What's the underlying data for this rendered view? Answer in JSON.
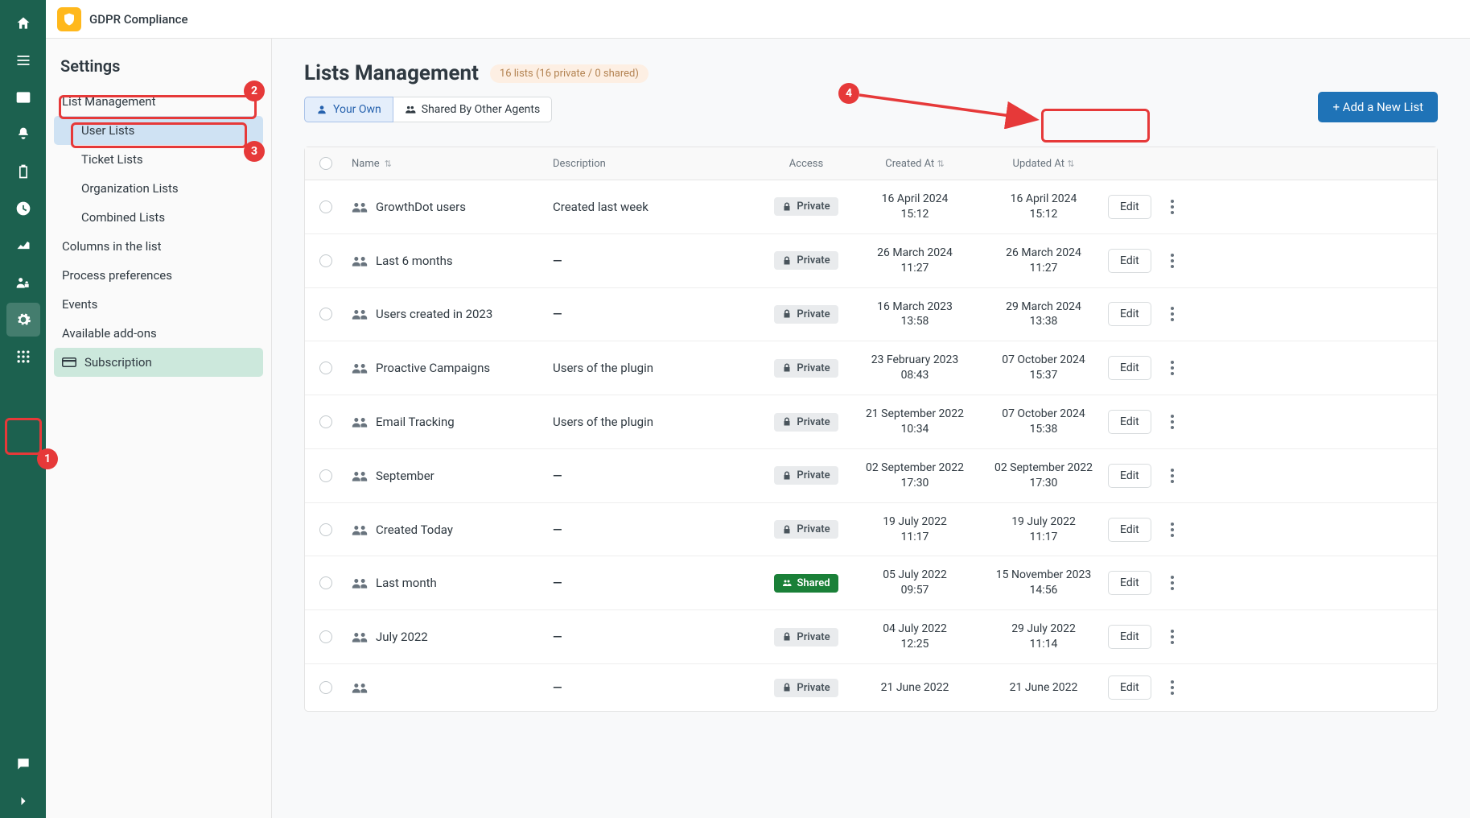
{
  "brand_title": "GDPR Compliance",
  "settings": {
    "title": "Settings",
    "items": {
      "list_mgmt": "List Management",
      "user_lists": "User Lists",
      "ticket_lists": "Ticket Lists",
      "org_lists": "Organization Lists",
      "combined_lists": "Combined Lists",
      "columns": "Columns in the list",
      "process_prefs": "Process preferences",
      "events": "Events",
      "addons": "Available add-ons",
      "subscription": "Subscription"
    }
  },
  "page": {
    "title": "Lists Management",
    "count_text": "16 lists (16 private / 0 shared)",
    "tab_own": "Your Own",
    "tab_shared": "Shared By Other Agents",
    "add_btn": "+ Add a New List"
  },
  "table": {
    "headers": {
      "name": "Name",
      "desc": "Description",
      "access": "Access",
      "created": "Created At",
      "updated": "Updated At"
    },
    "edit_label": "Edit",
    "access_private": "Private",
    "access_shared": "Shared",
    "rows": [
      {
        "name": "GrowthDot users",
        "desc": "Created last week",
        "access": "private",
        "created": "16 April 2024",
        "created_t": "15:12",
        "updated": "16 April 2024",
        "updated_t": "15:12"
      },
      {
        "name": "Last 6 months",
        "desc": "—",
        "access": "private",
        "created": "26 March 2024",
        "created_t": "11:27",
        "updated": "26 March 2024",
        "updated_t": "11:27"
      },
      {
        "name": "Users created in 2023",
        "desc": "—",
        "access": "private",
        "created": "16 March 2023",
        "created_t": "13:58",
        "updated": "29 March 2024",
        "updated_t": "13:38"
      },
      {
        "name": "Proactive Campaigns",
        "desc": "Users of the plugin",
        "access": "private",
        "created": "23 February 2023",
        "created_t": "08:43",
        "updated": "07 October 2024",
        "updated_t": "15:37"
      },
      {
        "name": "Email Tracking",
        "desc": "Users of the plugin",
        "access": "private",
        "created": "21 September 2022",
        "created_t": "10:34",
        "updated": "07 October 2024",
        "updated_t": "15:38"
      },
      {
        "name": "September",
        "desc": "—",
        "access": "private",
        "created": "02 September 2022",
        "created_t": "17:30",
        "updated": "02 September 2022",
        "updated_t": "17:30"
      },
      {
        "name": "Created Today",
        "desc": "—",
        "access": "private",
        "created": "19 July 2022",
        "created_t": "11:17",
        "updated": "19 July 2022",
        "updated_t": "11:17"
      },
      {
        "name": "Last month",
        "desc": "—",
        "access": "shared",
        "created": "05 July 2022",
        "created_t": "09:57",
        "updated": "15 November 2023",
        "updated_t": "14:56"
      },
      {
        "name": "July 2022",
        "desc": "—",
        "access": "private",
        "created": "04 July 2022",
        "created_t": "12:25",
        "updated": "29 July 2022",
        "updated_t": "11:14"
      },
      {
        "name": "",
        "desc": "—",
        "access": "private",
        "created": "21 June 2022",
        "created_t": "",
        "updated": "21 June 2022",
        "updated_t": ""
      }
    ]
  },
  "annotations": {
    "b1": "1",
    "b2": "2",
    "b3": "3",
    "b4": "4"
  }
}
